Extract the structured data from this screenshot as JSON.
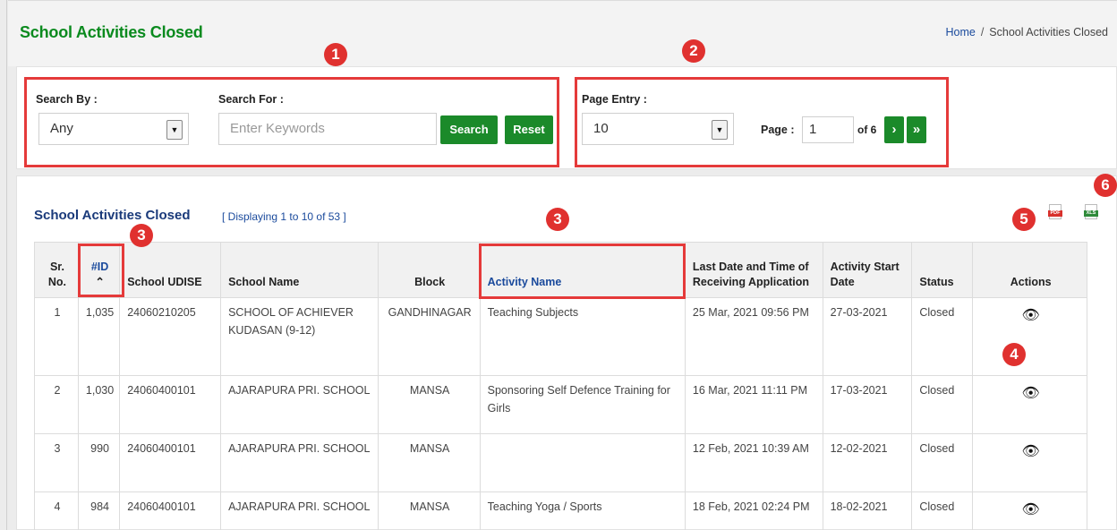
{
  "header": {
    "title": "School Activities Closed",
    "breadcrumb": {
      "home": "Home",
      "separator": "/",
      "current": "School Activities Closed"
    }
  },
  "filters": {
    "search_by_label": "Search By :",
    "search_by_value": "Any",
    "search_for_label": "Search For :",
    "search_placeholder": "Enter Keywords",
    "search_button": "Search",
    "reset_button": "Reset",
    "page_entry_label": "Page Entry :",
    "page_entry_value": "10",
    "page_label": "Page :",
    "page_value": "1",
    "page_of": "of 6",
    "next_button": "›",
    "last_button": "»"
  },
  "table": {
    "title": "School Activities Closed",
    "subtitle": "[ Displaying 1 to 10 of 53 ]",
    "export_pdf": "PDF",
    "export_xls": "XLS",
    "columns": {
      "sr": "Sr. No.",
      "id": "#ID",
      "udise": "School UDISE",
      "school": "School Name",
      "block": "Block",
      "activity": "Activity Name",
      "last_date": "Last Date and Time of Receiving Application",
      "start_date": "Activity Start Date",
      "status": "Status",
      "actions": "Actions"
    },
    "rows": [
      {
        "sr": "1",
        "id": "1,035",
        "udise": "24060210205",
        "school": "SCHOOL OF ACHIEVER KUDASAN (9-12)",
        "block": "GANDHINAGAR",
        "activity": "Teaching Subjects",
        "last_date": "25 Mar, 2021 09:56 PM",
        "start_date": "27-03-2021",
        "status": "Closed"
      },
      {
        "sr": "2",
        "id": "1,030",
        "udise": "24060400101",
        "school": "AJARAPURA PRI. SCHOOL",
        "block": "MANSA",
        "activity": "Sponsoring Self Defence Training for Girls",
        "last_date": "16 Mar, 2021 11:11 PM",
        "start_date": "17-03-2021",
        "status": "Closed"
      },
      {
        "sr": "3",
        "id": "990",
        "udise": "24060400101",
        "school": "AJARAPURA PRI. SCHOOL",
        "block": "MANSA",
        "activity": "",
        "last_date": "12 Feb, 2021 10:39 AM",
        "start_date": "12-02-2021",
        "status": "Closed"
      },
      {
        "sr": "4",
        "id": "984",
        "udise": "24060400101",
        "school": "AJARAPURA PRI. SCHOOL",
        "block": "MANSA",
        "activity": "Teaching Yoga / Sports",
        "last_date": "18 Feb, 2021 02:24 PM",
        "start_date": "18-02-2021",
        "status": "Closed"
      }
    ]
  },
  "annotations": {
    "n1": "1",
    "n2": "2",
    "n3a": "3",
    "n3b": "3",
    "n4": "4",
    "n5": "5",
    "n6": "6"
  },
  "colors": {
    "accent_green": "#1b8a2a",
    "title_green": "#0a8a1e",
    "link_blue": "#1a4a9c",
    "annotation_red": "#e0312f"
  }
}
